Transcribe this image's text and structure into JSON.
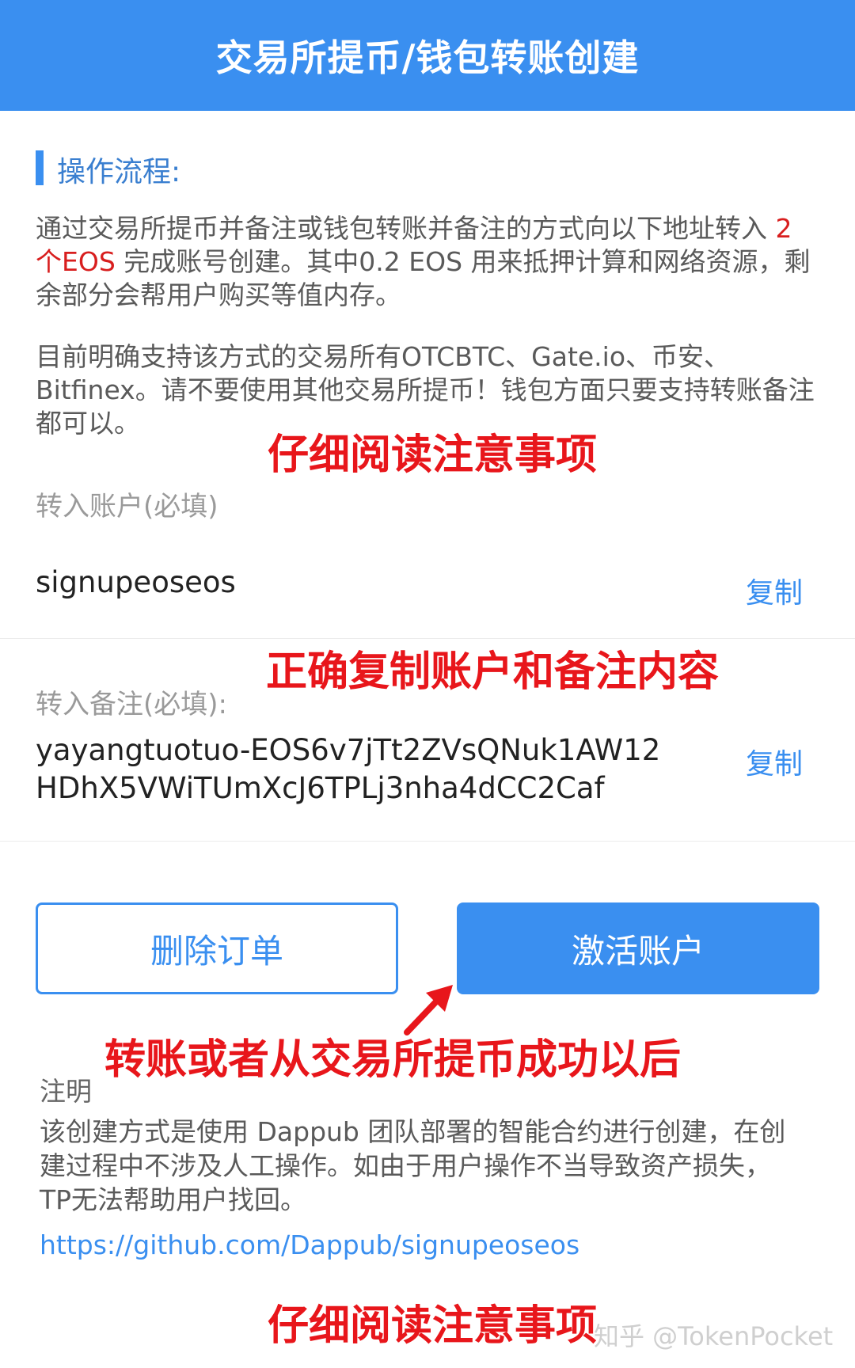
{
  "header": {
    "title": "交易所提币/钱包转账创建"
  },
  "section": {
    "title": "操作流程:"
  },
  "flow": {
    "p1_before": "通过交易所提币并备注或钱包转账并备注的方式向以下地址转入 ",
    "p1_highlight": "2个EOS",
    "p1_after": " 完成账号创建。其中0.2 EOS 用来抵押计算和网络资源，剩余部分会帮用户购买等值内存。",
    "p2": "目前明确支持该方式的交易所有OTCBTC、Gate.io、币安、Bitfinex。请不要使用其他交易所提币！钱包方面只要支持转账备注都可以。"
  },
  "annotations": {
    "read_notes_1": "仔细阅读注意事项",
    "copy_correctly": "正确复制账户和备注内容",
    "after_success": "转账或者从交易所提币成功以后",
    "read_notes_2": "仔细阅读注意事项"
  },
  "account": {
    "label": "转入账户(必填)",
    "value": "signupeoseos",
    "copy_label": "复制"
  },
  "memo": {
    "label": "转入备注(必填):",
    "value_line1": "yayangtuotuo-EOS6v7jTt2ZVsQNuk1AW12",
    "value_line2": "HDhX5VWiTUmXcJ6TPLj3nha4dCC2Caf",
    "copy_label": "复制"
  },
  "buttons": {
    "delete_label": "删除订单",
    "activate_label": "激活账户"
  },
  "note": {
    "title": "注明",
    "text": "该创建方式是使用 Dappub 团队部署的智能合约进行创建，在创建过程中不涉及人工操作。如由于用户操作不当导致资产损失，TP无法帮助用户找回。",
    "link": "https://github.com/Dappub/signupeoseos"
  },
  "watermark": "知乎 @TokenPocket",
  "colors": {
    "accent": "#3a8ff0",
    "annotation": "#e8161b"
  }
}
